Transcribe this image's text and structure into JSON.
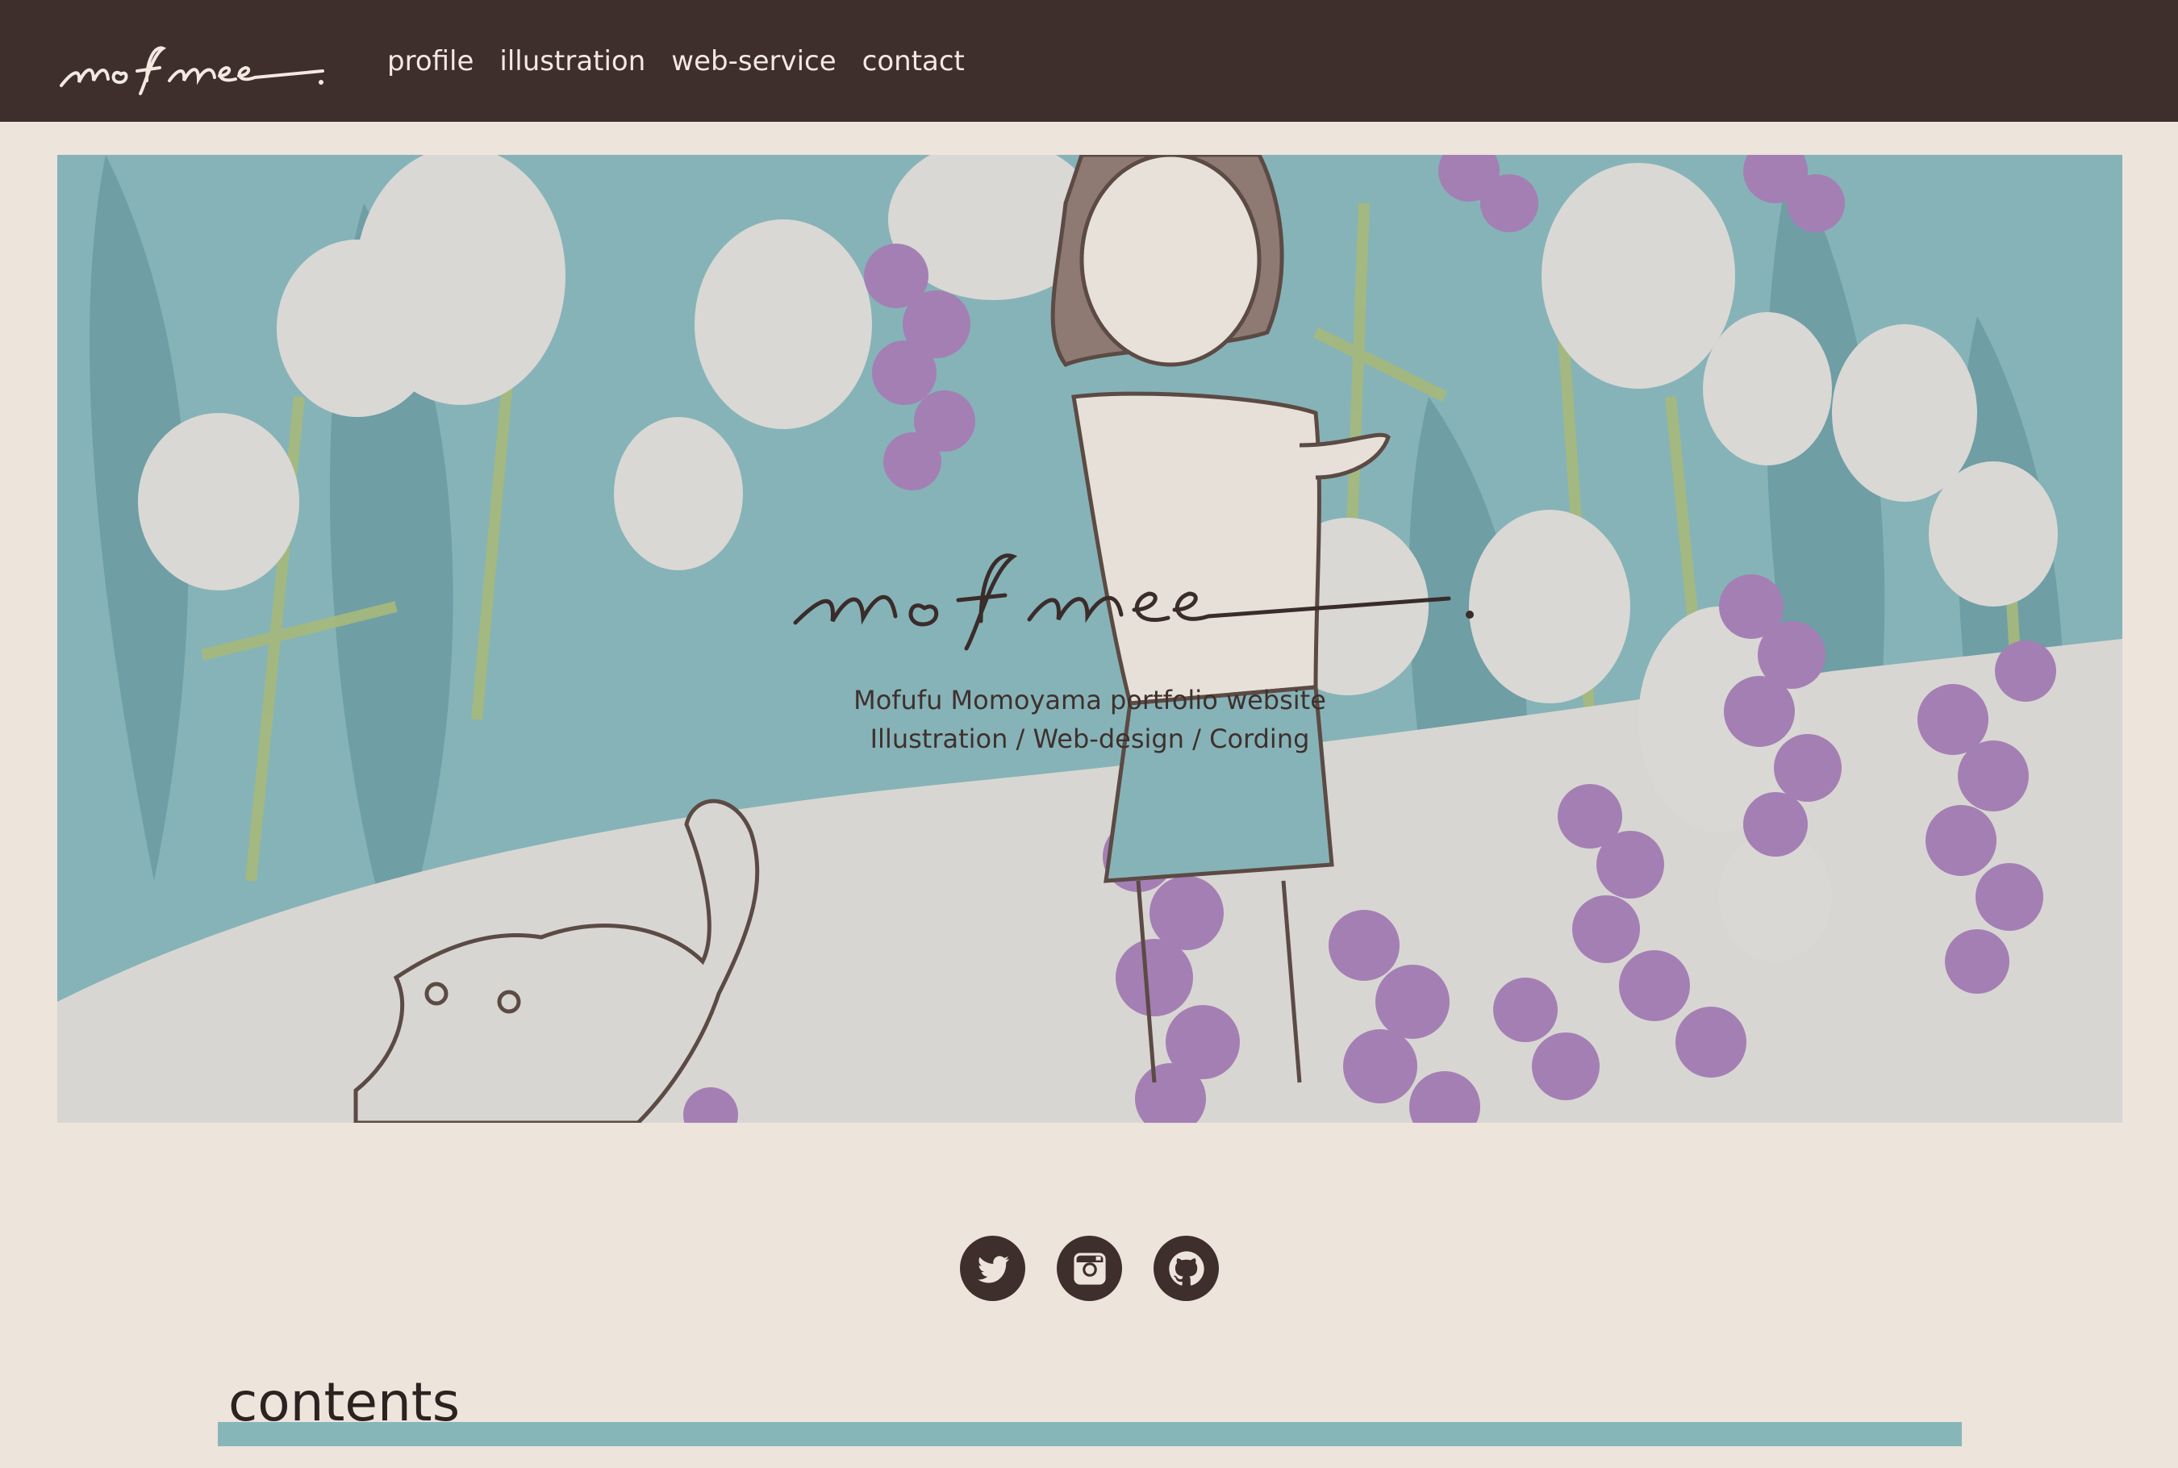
{
  "brand": {
    "logo_text": "mofmee."
  },
  "nav": {
    "items": [
      {
        "label": "profile"
      },
      {
        "label": "illustration"
      },
      {
        "label": "web-service"
      },
      {
        "label": "contact"
      }
    ]
  },
  "hero": {
    "logo_text": "mofmee.",
    "tagline_line1": "Mofufu Momoyama portfolio website",
    "tagline_line2": "Illustration / Web-design / Cording"
  },
  "social": [
    {
      "icon": "twitter-icon"
    },
    {
      "icon": "instagram-icon"
    },
    {
      "icon": "github-icon"
    }
  ],
  "section": {
    "title": "contents"
  },
  "colors": {
    "header_bg": "#3e2e2c",
    "page_bg": "#ede4dc",
    "accent_teal": "#87b6b8",
    "accent_purple": "#a47fb4"
  }
}
